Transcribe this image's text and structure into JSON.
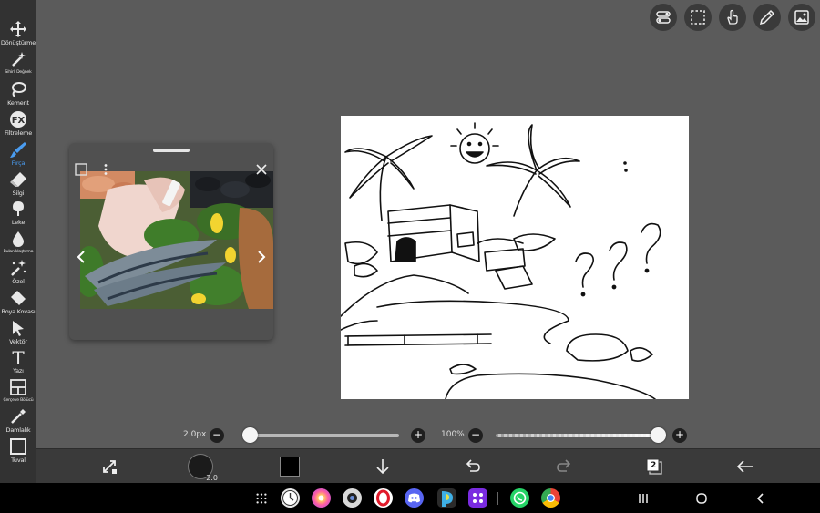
{
  "left_toolbar": {
    "tools": [
      {
        "label": "Dönüştürme",
        "icon": "move-icon"
      },
      {
        "label": "Sihirli Değnek",
        "icon": "magic-wand-icon"
      },
      {
        "label": "Kement",
        "icon": "lasso-icon"
      },
      {
        "label": "Filtreleme",
        "icon": "fx-icon",
        "icon_text": "FX"
      },
      {
        "label": "Fırça",
        "icon": "brush-icon",
        "active": true
      },
      {
        "label": "Silgi",
        "icon": "eraser-icon"
      },
      {
        "label": "Leke",
        "icon": "smudge-icon"
      },
      {
        "label": "Bulanıklaştırma",
        "icon": "blur-icon"
      },
      {
        "label": "Özel",
        "icon": "custom-sparkle-icon"
      },
      {
        "label": "Boya Kovası",
        "icon": "paint-bucket-icon"
      },
      {
        "label": "Vektör",
        "icon": "vector-cursor-icon"
      },
      {
        "label": "Yazı",
        "icon": "text-icon",
        "icon_text": "T"
      },
      {
        "label": "Çerçeve Bölücü",
        "icon": "frame-divider-icon"
      },
      {
        "label": "Damlalık",
        "icon": "eyedropper-icon"
      },
      {
        "label": "Tuval",
        "icon": "canvas-icon"
      }
    ]
  },
  "top_tools": [
    {
      "name": "toggle-panel-icon"
    },
    {
      "name": "selection-icon"
    },
    {
      "name": "touch-hand-icon"
    },
    {
      "name": "ruler-pen-icon"
    },
    {
      "name": "image-material-icon"
    }
  ],
  "reference_window": {
    "image_name": "fish-reference-image"
  },
  "sliders": {
    "brush_size": {
      "value_text": "2.0px",
      "minus": "−",
      "plus": "+",
      "level": 0.02
    },
    "opacity": {
      "value_text": "100%",
      "minus": "−",
      "plus": "+",
      "level": 1.0
    }
  },
  "bottom_toolbar": {
    "brush_size_badge": "2.0",
    "layer_count": "2",
    "color": "#000000"
  },
  "system_bar": {
    "apps": [
      "clock-app-icon",
      "photos-app-icon",
      "camera-app-icon",
      "opera-app-icon",
      "discord-app-icon",
      "ibis-paint-app-icon",
      "game-app-icon",
      "whatsapp-app-icon",
      "chrome-app-icon"
    ]
  },
  "colors": {
    "accent": "#4a9cf0",
    "toolbar_bg": "#323232",
    "workspace_bg": "#5b5b5b"
  }
}
